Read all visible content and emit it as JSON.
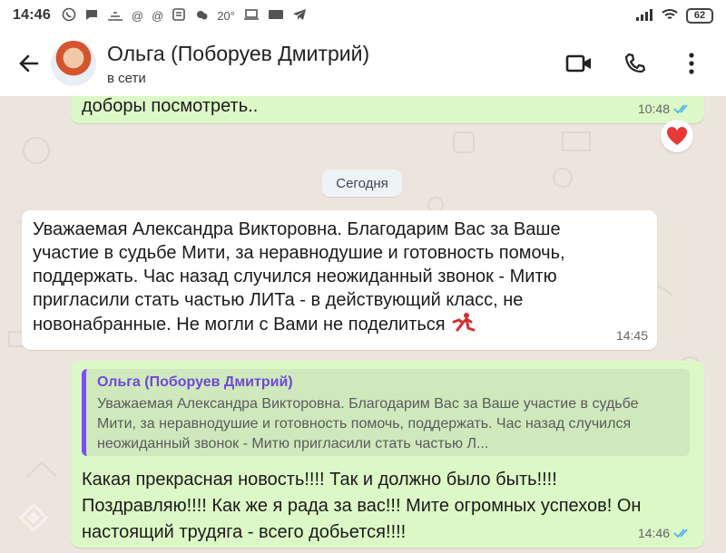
{
  "status_bar": {
    "time": "14:46",
    "temperature": "20°",
    "battery": "62",
    "icons": [
      "whatsapp-icon",
      "chat-icon",
      "signal-icon",
      "at-icon",
      "at-icon",
      "mail-icon",
      "weather-icon",
      "laptop-icon",
      "keyboard-icon",
      "telegram-icon"
    ]
  },
  "header": {
    "contact_name": "Ольга (Поборуев Дмитрий)",
    "status": "в сети",
    "actions": [
      "video-call",
      "voice-call",
      "more-options"
    ]
  },
  "messages": [
    {
      "direction": "outgoing",
      "text": "доборы посмотреть..",
      "time": "10:48",
      "read": true,
      "reaction": "heart"
    },
    {
      "direction": "incoming",
      "text": "Уважаемая Александра Викторовна. Благодарим Вас за Ваше участие в судьбе Мити, за неравнодушие и готовность помочь, поддержать. Час назад случился неожиданный звонок - Митю пригласили стать частью ЛИТа - в действующий класс, не новонабранные. Не могли с Вами не поделиться",
      "time": "14:45"
    },
    {
      "direction": "outgoing",
      "quote_author": "Ольга (Поборуев Дмитрий)",
      "quote_text": "Уважаемая Александра Викторовна. Благодарим Вас за Ваше участие в судьбе Мити, за неравнодушие и готовность помочь, поддержать. Час назад случился неожиданный звонок - Митю пригласили стать частью Л...",
      "text": "Какая прекрасная новость!!!! Так и должно было быть!!!! Поздравляю!!!! Как же я рада за вас!!! Мите огромных успехов! Он настоящий трудяга - всего добьется!!!!",
      "time": "14:46",
      "read": true
    }
  ],
  "date_separator": "Сегодня",
  "colors": {
    "outgoing_bubble": "#dcf8c6",
    "incoming_bubble": "#ffffff",
    "chat_background": "#ece5dd",
    "read_ticks": "#4fb6ec",
    "quote_accent": "#7c4dff"
  }
}
